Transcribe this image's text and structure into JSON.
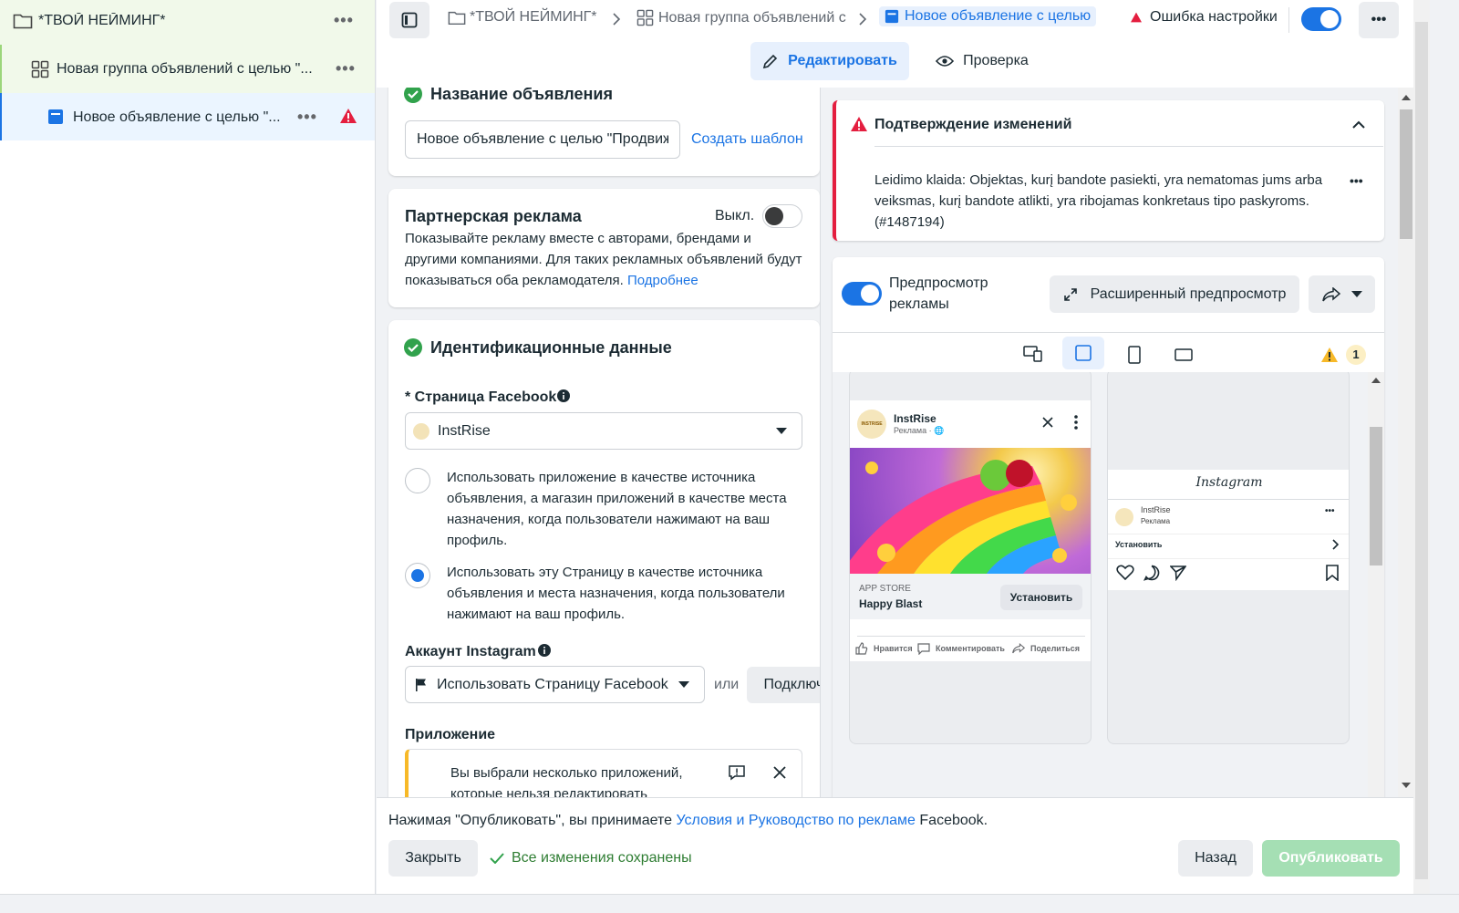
{
  "tree": {
    "campaign": "*ТВОЙ НЕЙМИНГ*",
    "adset": "Новая группа объявлений с целью \"...",
    "ad": "Новое объявление с целью \"...",
    "more": "•••"
  },
  "breadcrumb": {
    "campaign": "*ТВОЙ НЕЙМИНГ*",
    "adset": "Новая группа объявлений с",
    "ad": "Новое объявление с целью",
    "error": "Ошибка настройки"
  },
  "modes": {
    "edit": "Редактировать",
    "review": "Проверка"
  },
  "ad_name": {
    "title": "Название объявления",
    "value": "Новое объявление с целью \"Продвижение приложения\"",
    "template_link": "Создать шаблон"
  },
  "partner": {
    "title": "Партнерская реклама",
    "toggle_label": "Выкл.",
    "description": "Показывайте рекламу вместе с авторами, брендами и другими компаниями. Для таких рекламных объявлений будут показываться оба рекламодателя. ",
    "more_link": "Подробнее"
  },
  "identity": {
    "title": "Идентификационные данные",
    "fb_page_label": "* Страница Facebook",
    "fb_page_value": "InstRise",
    "option1": "Использовать приложение в качестве источника объявления, а магазин приложений в качестве места назначения, когда пользователи нажимают на ваш профиль.",
    "option2": "Использовать эту Страницу в качестве источника объявления и места назначения, когда пользователи нажимают на ваш профиль.",
    "ig_label": "Аккаунт Instagram",
    "ig_value": "Использовать Страницу Facebook",
    "or": "или",
    "connect": "Подключить аккаунт",
    "app_label": "Приложение",
    "app_notice": "Вы выбрали несколько приложений, которые нельзя редактировать"
  },
  "error_card": {
    "title": "Подтверждение изменений",
    "message": "Leidimo klaida: Objektas, kurį bandote pasiekti, yra nematomas jums arba veiksmas, kurį bandote atlikti, yra ribojamas konkretaus tipo paskyroms. (#1487194)"
  },
  "preview": {
    "toggle_label": "Предпросмотр рекламы",
    "advanced": "Расширенный предпросмотр",
    "warn_count": "1",
    "fb": {
      "brand": "InstRise",
      "sponsored": "Реклама · ",
      "store": "APP STORE",
      "app": "Happy Blast",
      "install": "Установить",
      "like": "Нравится",
      "comment": "Комментировать",
      "share": "Поделиться",
      "logo_text": "INSTRISE"
    },
    "ig": {
      "logo": "Instagram",
      "brand": "InstRise",
      "sponsored": "Реклама",
      "install": "Установить"
    }
  },
  "footer": {
    "terms_prefix": "Нажимая \"Опубликовать\", вы принимаете ",
    "terms_link": "Условия и Руководство по рекламе",
    "terms_suffix": " Facebook.",
    "close": "Закрыть",
    "saved": "Все изменения сохранены",
    "back": "Назад",
    "publish": "Опубликовать"
  },
  "colors": {
    "accent": "#1b74e4",
    "success": "#31a24c",
    "error": "#e41e3f",
    "warning": "#f7b928",
    "tree_selected_bg": "#ebf5ff",
    "tree_campaign_bg": "#f1f9ea"
  }
}
